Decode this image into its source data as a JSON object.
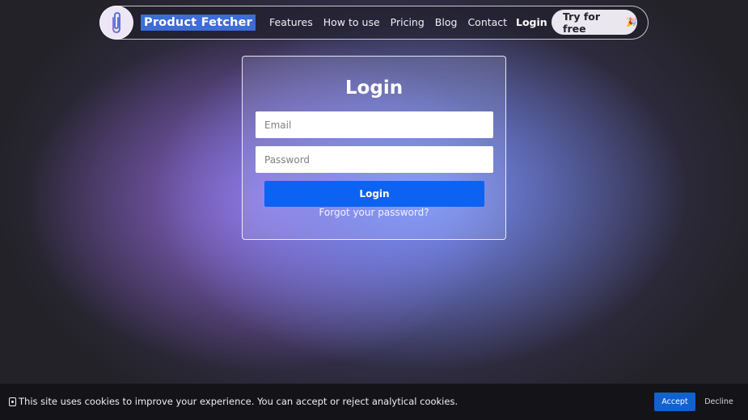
{
  "navbar": {
    "logo_icon": "paperclip-icon",
    "brand": "Product Fetcher",
    "links": [
      "Features",
      "How to use",
      "Pricing",
      "Blog",
      "Contact"
    ],
    "login": "Login",
    "cta": "Try for free",
    "cta_icon": "party-popper-icon"
  },
  "login_card": {
    "title": "Login",
    "email_placeholder": "Email",
    "password_placeholder": "Password",
    "submit_label": "Login",
    "forgot_link": "Forgot your password?",
    "button_color": "#0c62f2"
  },
  "cookie_banner": {
    "icon": "cookie-icon",
    "text": "This site uses cookies to improve your experience. You can accept or reject analytical cookies.",
    "accept": "Accept",
    "decline": "Decline",
    "accept_color": "#1261cc"
  }
}
